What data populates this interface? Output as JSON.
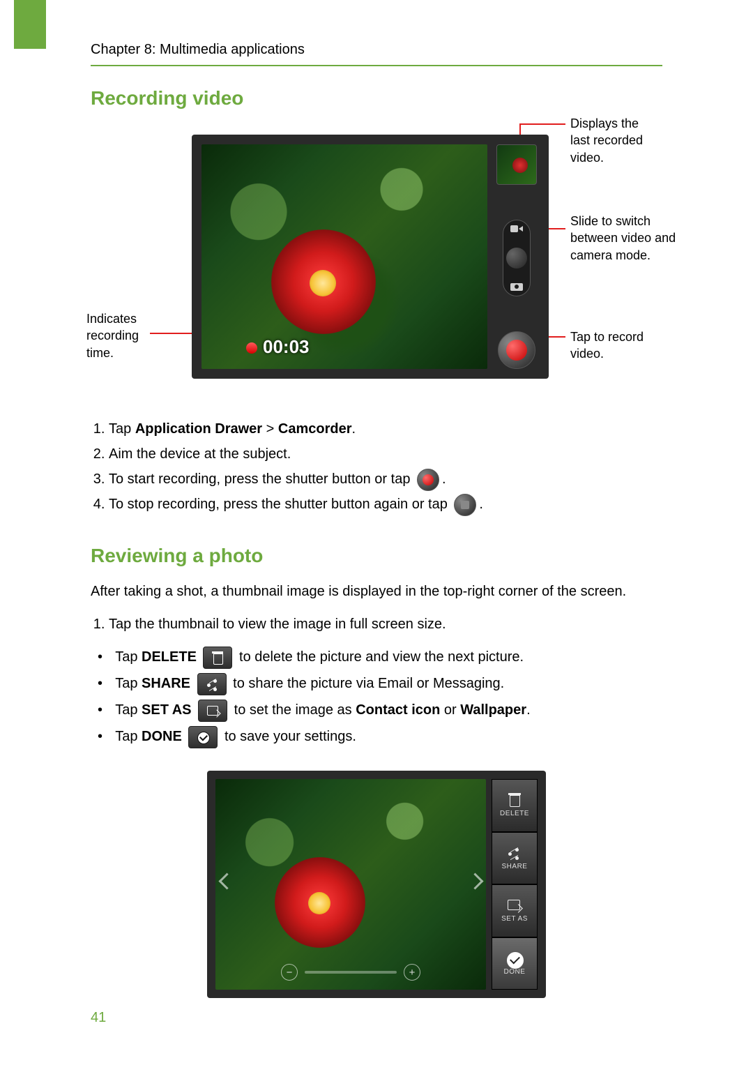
{
  "chapter": "Chapter 8: Multimedia applications",
  "page_number": "41",
  "section1": {
    "heading": "Recording video",
    "callouts": {
      "thumbnail": "Displays the last recorded video.",
      "mode_switch": "Slide to switch between video and camera mode.",
      "record": "Tap to record video.",
      "time": "Indicates recording time."
    },
    "record_time": "00:03",
    "steps": {
      "s1_pre": "Tap ",
      "s1_b1": "Application Drawer",
      "s1_mid": " > ",
      "s1_b2": "Camcorder",
      "s1_post": ".",
      "s2": "Aim the device at the subject.",
      "s3_pre": "To start recording, press the shutter button or tap",
      "s3_post": ".",
      "s4_pre": "To stop recording, press the shutter button again or tap",
      "s4_post": "."
    }
  },
  "section2": {
    "heading": "Reviewing a photo",
    "intro": "After taking a shot, a thumbnail image is displayed in the top-right corner of the screen.",
    "step1": "Tap the thumbnail to view the image in full screen size.",
    "bullets": {
      "b1_pre": "Tap ",
      "b1_b": "DELETE",
      "b1_post": " to delete the picture and view the next picture.",
      "b2_pre": "Tap ",
      "b2_b": "SHARE",
      "b2_post": " to share the picture via Email or Messaging.",
      "b3_pre": "Tap ",
      "b3_b": "SET AS",
      "b3_mid": " to set the image as ",
      "b3_b2": "Contact icon",
      "b3_mid2": " or ",
      "b3_b3": "Wallpaper",
      "b3_post": ".",
      "b4_pre": "Tap ",
      "b4_b": "DONE",
      "b4_post": " to save your settings."
    },
    "side_buttons": {
      "delete": "DELETE",
      "share": "SHARE",
      "setas": "SET AS",
      "done": "DONE"
    }
  }
}
